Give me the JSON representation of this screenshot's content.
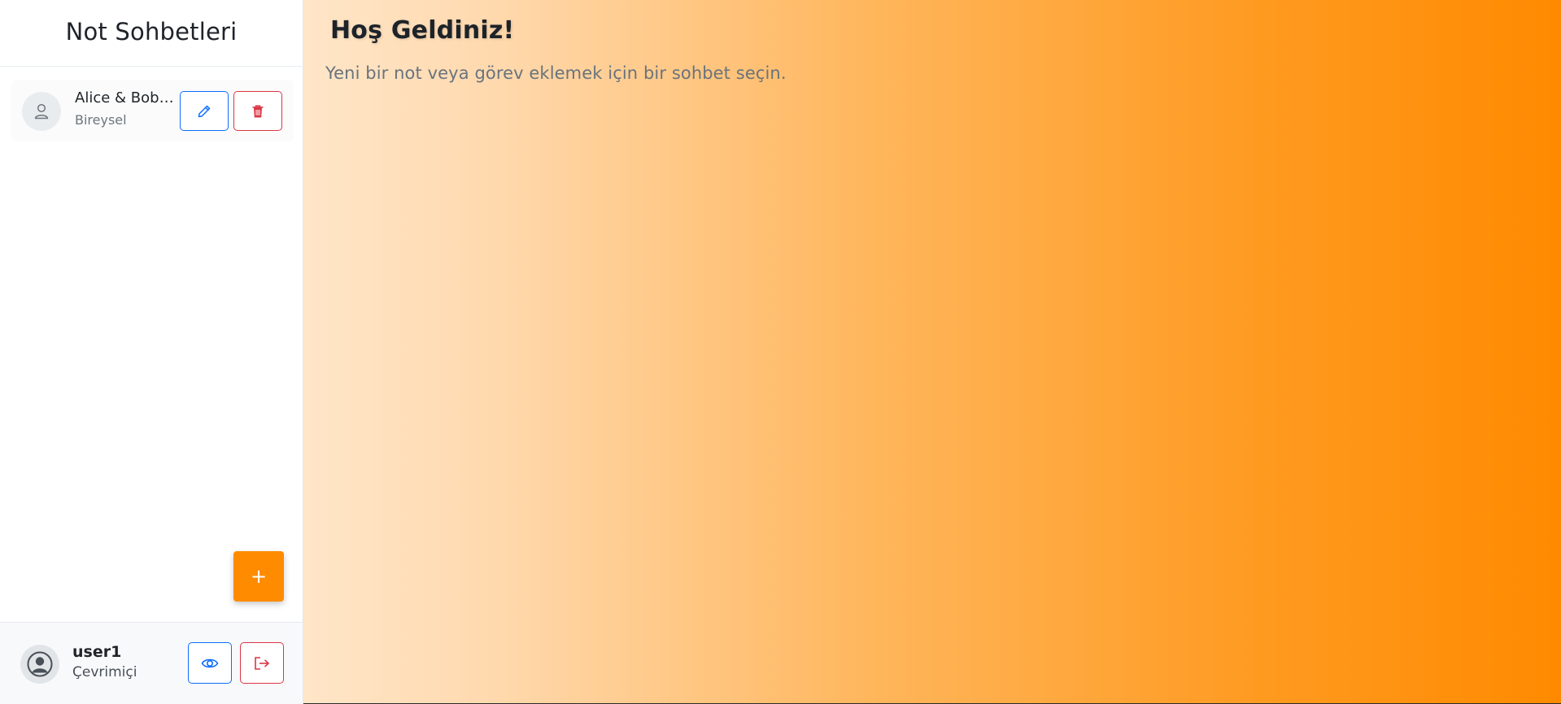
{
  "sidebar": {
    "title": "Not Sohbetleri",
    "chats": [
      {
        "name": "Alice & Bob ...",
        "type": "Bireysel",
        "icons": [
          "user-icon",
          "pencil-icon",
          "trash-icon"
        ]
      }
    ],
    "add_button_label": "+",
    "footer": {
      "username": "user1",
      "status": "Çevrimiçi",
      "icons": [
        "user-circle-icon",
        "eye-icon",
        "logout-icon"
      ]
    }
  },
  "main": {
    "welcome_title": "Hoş Geldiniz!",
    "welcome_subtitle": "Yeni bir not veya görev eklemek için bir sohbet seçin."
  },
  "colors": {
    "accent": "#ff8c00",
    "primary_blue": "#0d6efd",
    "danger_red": "#dc3545",
    "gradient_start": "#ffe6c8",
    "gradient_end": "#ff8a00"
  }
}
